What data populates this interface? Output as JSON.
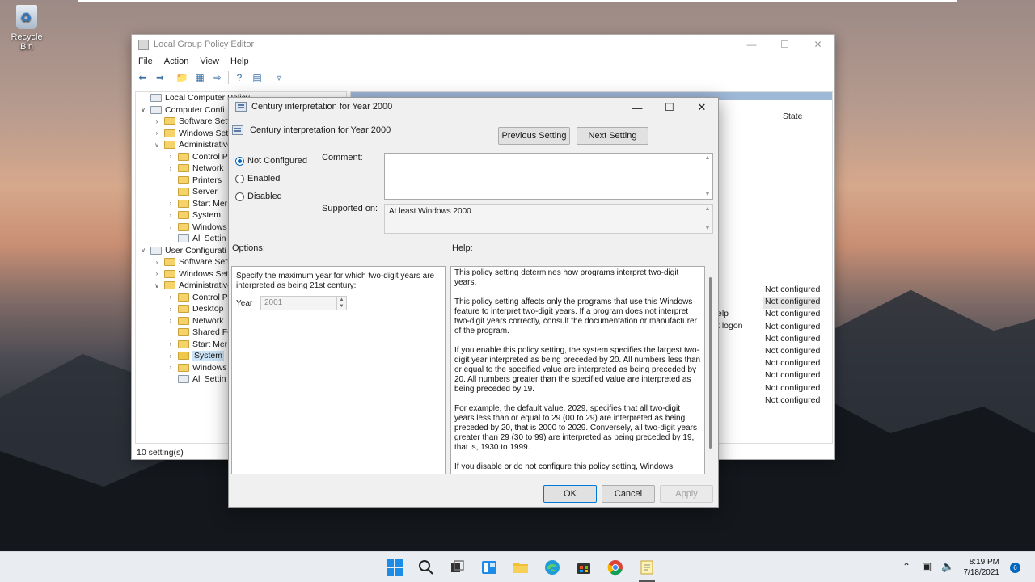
{
  "desktop": {
    "recycle_bin_label": "Recycle Bin"
  },
  "gpe": {
    "title": "Local Group Policy Editor",
    "menu": [
      "File",
      "Action",
      "View",
      "Help"
    ],
    "tree": [
      {
        "label": "Local Computer Policy",
        "indent": 0,
        "tw": "",
        "icon": "doc"
      },
      {
        "label": "Computer Confi",
        "indent": 0,
        "tw": "v",
        "icon": "doc"
      },
      {
        "label": "Software Setti",
        "indent": 1,
        "tw": ">",
        "icon": "folder"
      },
      {
        "label": "Windows Setti",
        "indent": 1,
        "tw": ">",
        "icon": "folder"
      },
      {
        "label": "Administrative",
        "indent": 1,
        "tw": "v",
        "icon": "folder"
      },
      {
        "label": "Control P",
        "indent": 2,
        "tw": ">",
        "icon": "folder"
      },
      {
        "label": "Network",
        "indent": 2,
        "tw": ">",
        "icon": "folder"
      },
      {
        "label": "Printers",
        "indent": 2,
        "tw": "",
        "icon": "folder"
      },
      {
        "label": "Server",
        "indent": 2,
        "tw": "",
        "icon": "folder"
      },
      {
        "label": "Start Mer",
        "indent": 2,
        "tw": ">",
        "icon": "folder"
      },
      {
        "label": "System",
        "indent": 2,
        "tw": ">",
        "icon": "folder"
      },
      {
        "label": "Windows",
        "indent": 2,
        "tw": ">",
        "icon": "folder"
      },
      {
        "label": "All Settin",
        "indent": 2,
        "tw": "",
        "icon": "doc"
      },
      {
        "label": "User Configurati",
        "indent": 0,
        "tw": "v",
        "icon": "doc"
      },
      {
        "label": "Software Setti",
        "indent": 1,
        "tw": ">",
        "icon": "folder"
      },
      {
        "label": "Windows Setti",
        "indent": 1,
        "tw": ">",
        "icon": "folder"
      },
      {
        "label": "Administrative",
        "indent": 1,
        "tw": "v",
        "icon": "folder"
      },
      {
        "label": "Control P",
        "indent": 2,
        "tw": ">",
        "icon": "folder"
      },
      {
        "label": "Desktop",
        "indent": 2,
        "tw": ">",
        "icon": "folder"
      },
      {
        "label": "Network",
        "indent": 2,
        "tw": ">",
        "icon": "folder"
      },
      {
        "label": "Shared Fo",
        "indent": 2,
        "tw": "",
        "icon": "folder"
      },
      {
        "label": "Start Mer",
        "indent": 2,
        "tw": ">",
        "icon": "folder"
      },
      {
        "label": "System",
        "indent": 2,
        "tw": ">",
        "icon": "folder",
        "selected": true
      },
      {
        "label": "Windows",
        "indent": 2,
        "tw": ">",
        "icon": "folder"
      },
      {
        "label": "All Settin",
        "indent": 2,
        "tw": "",
        "icon": "doc"
      }
    ],
    "state_header": "State",
    "states": [
      "Not configured",
      "Not configured",
      "Not configured",
      "Not configured",
      "Not configured",
      "Not configured",
      "Not configured",
      "Not configured",
      "Not configured",
      "Not configured"
    ],
    "partial_labels": [
      "elp",
      "t logon"
    ],
    "status": "10 setting(s)"
  },
  "dialog": {
    "title": "Century interpretation for Year 2000",
    "subtitle": "Century interpretation for Year 2000",
    "prev_label": "Previous Setting",
    "next_label": "Next Setting",
    "radios": {
      "not_configured": "Not Configured",
      "enabled": "Enabled",
      "disabled": "Disabled"
    },
    "comment_label": "Comment:",
    "supported_label": "Supported on:",
    "supported_value": "At least Windows 2000",
    "options_label": "Options:",
    "help_label": "Help:",
    "options_text": "Specify the maximum year for which two-digit years are interpreted as being 21st century:",
    "year_label": "Year",
    "year_value": "2001",
    "help": [
      "This policy setting determines how programs interpret two-digit years.",
      "This policy setting affects only the programs that use this Windows feature to interpret two-digit years. If a program does not interpret two-digit years correctly, consult the documentation or manufacturer of the program.",
      "If you enable this policy setting, the system specifies the largest two-digit year interpreted as being preceded by 20. All numbers less than or equal to the specified value are interpreted as being preceded by 20. All numbers greater than the specified value are interpreted as being preceded by 19.",
      "For example, the default value, 2029, specifies that all two-digit years less than or equal to 29 (00 to 29) are interpreted as being preceded by 20, that is 2000 to 2029. Conversely, all two-digit years greater than 29 (30 to 99) are interpreted as being preceded by 19, that is, 1930 to 1999.",
      "If you disable or do not configure this policy setting, Windows"
    ],
    "ok_label": "OK",
    "cancel_label": "Cancel",
    "apply_label": "Apply"
  },
  "taskbar": {
    "icons": [
      "windows-start-icon",
      "search-icon",
      "task-view-icon",
      "widgets-icon",
      "file-explorer-icon",
      "edge-icon",
      "store-icon",
      "chrome-icon",
      "notepad-icon"
    ],
    "time": "8:19 PM",
    "date": "7/18/2021",
    "notification_count": "6"
  }
}
